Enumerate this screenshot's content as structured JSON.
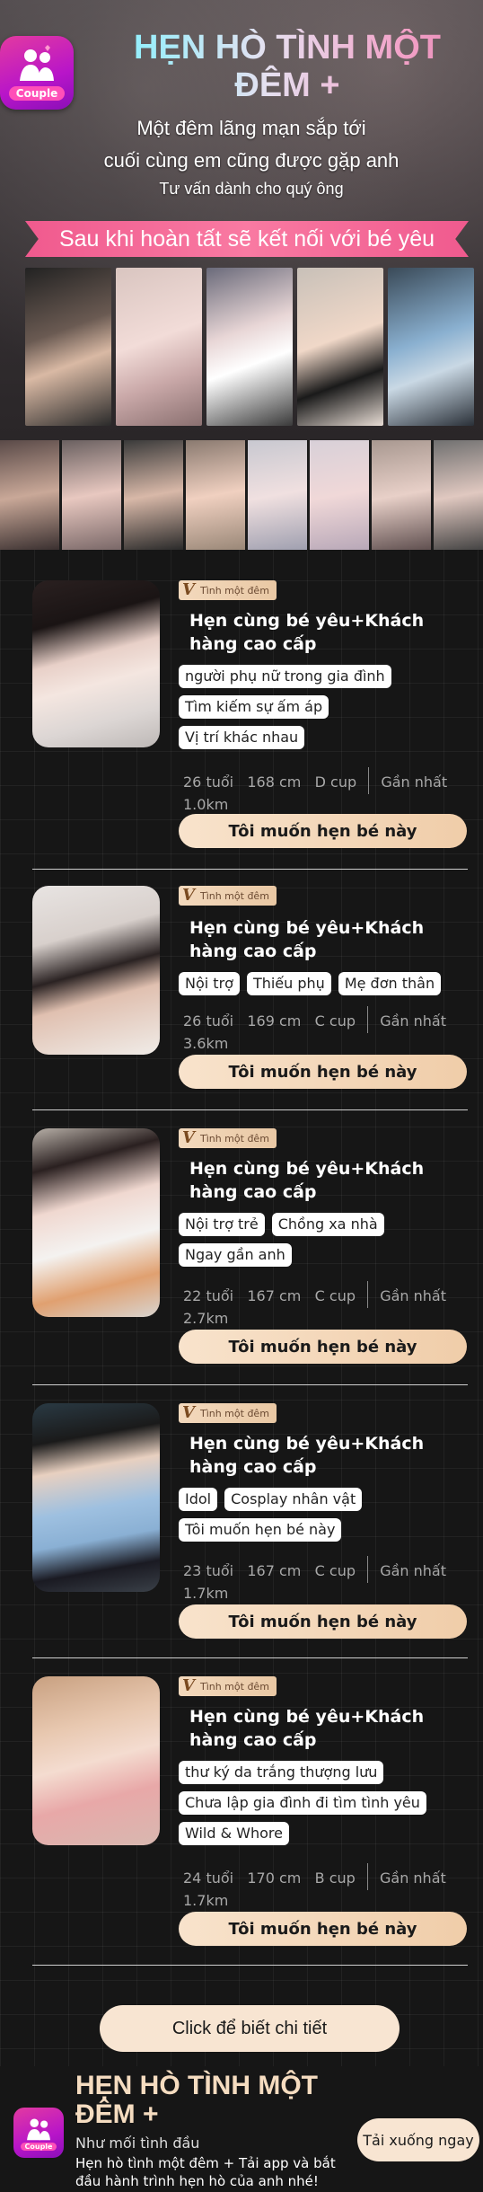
{
  "hero": {
    "logo_label": "Couple",
    "title": "HẸN HÒ TÌNH MỘT ĐÊM +",
    "line1": "Một đêm lãng mạn sắp tới",
    "line2": "cuối cùng em cũng được gặp anh",
    "line3": "Tư vấn dành cho quý ông",
    "banner": "Sau khi hoàn tất sẽ kết nối với bé yêu"
  },
  "cards": [
    {
      "tag": "Tình một đêm",
      "title": "Hẹn cùng bé yêu+Khách hàng cao cấp",
      "chips": [
        "người phụ nữ trong gia đình",
        "Tìm kiếm sự ấm áp",
        "Vị trí khác nhau"
      ],
      "age": "26 tuổi",
      "height": "168 cm",
      "cup": "D cup",
      "distance": "Gần nhất 1.0km",
      "cta": "Tôi muốn hẹn bé này"
    },
    {
      "tag": "Tình một đêm",
      "title": "Hẹn cùng bé yêu+Khách hàng cao cấp",
      "chips": [
        "Nội trợ",
        "Thiếu phụ",
        "Mẹ đơn thân"
      ],
      "age": "26 tuổi",
      "height": "169 cm",
      "cup": "C cup",
      "distance": "Gần nhất 3.6km",
      "cta": "Tôi muốn hẹn bé này"
    },
    {
      "tag": "Tình một đêm",
      "title": "Hẹn cùng bé yêu+Khách hàng cao cấp",
      "chips": [
        "Nội trợ trẻ",
        "Chồng xa nhà",
        "Ngay gần anh"
      ],
      "age": "22 tuổi",
      "height": "167 cm",
      "cup": "C cup",
      "distance": "Gần nhất 2.7km",
      "cta": "Tôi muốn hẹn bé này"
    },
    {
      "tag": "Tình một đêm",
      "title": "Hẹn cùng bé yêu+Khách hàng cao cấp",
      "chips": [
        "Idol",
        "Cosplay nhân vật",
        "Tôi muốn hẹn bé này"
      ],
      "age": "23 tuổi",
      "height": "167 cm",
      "cup": "C cup",
      "distance": "Gần nhất 1.7km",
      "cta": "Tôi muốn hẹn bé này"
    },
    {
      "tag": "Tình một đêm",
      "title": "Hẹn cùng bé yêu+Khách hàng cao cấp",
      "chips": [
        "thư ký da trắng thượng lưu",
        "Chưa lập gia đình đi tìm tình yêu",
        "Wild & Whore"
      ],
      "age": "24 tuổi",
      "height": "170 cm",
      "cup": "B cup",
      "distance": "Gần nhất 1.7km",
      "cta": "Tôi muốn hẹn bé này"
    }
  ],
  "more_button": "Click để biết chi tiết",
  "footer": {
    "logo_label": "Couple",
    "title": "HẸN HÒ TÌNH MỘT ĐÊM +",
    "subtitle": "Như mối tình đầu",
    "description": "Hẹn hò tình một đêm + Tải app và bắt đầu hành trình hẹn hò của anh nhé!",
    "download": "Tải xuống ngay"
  }
}
